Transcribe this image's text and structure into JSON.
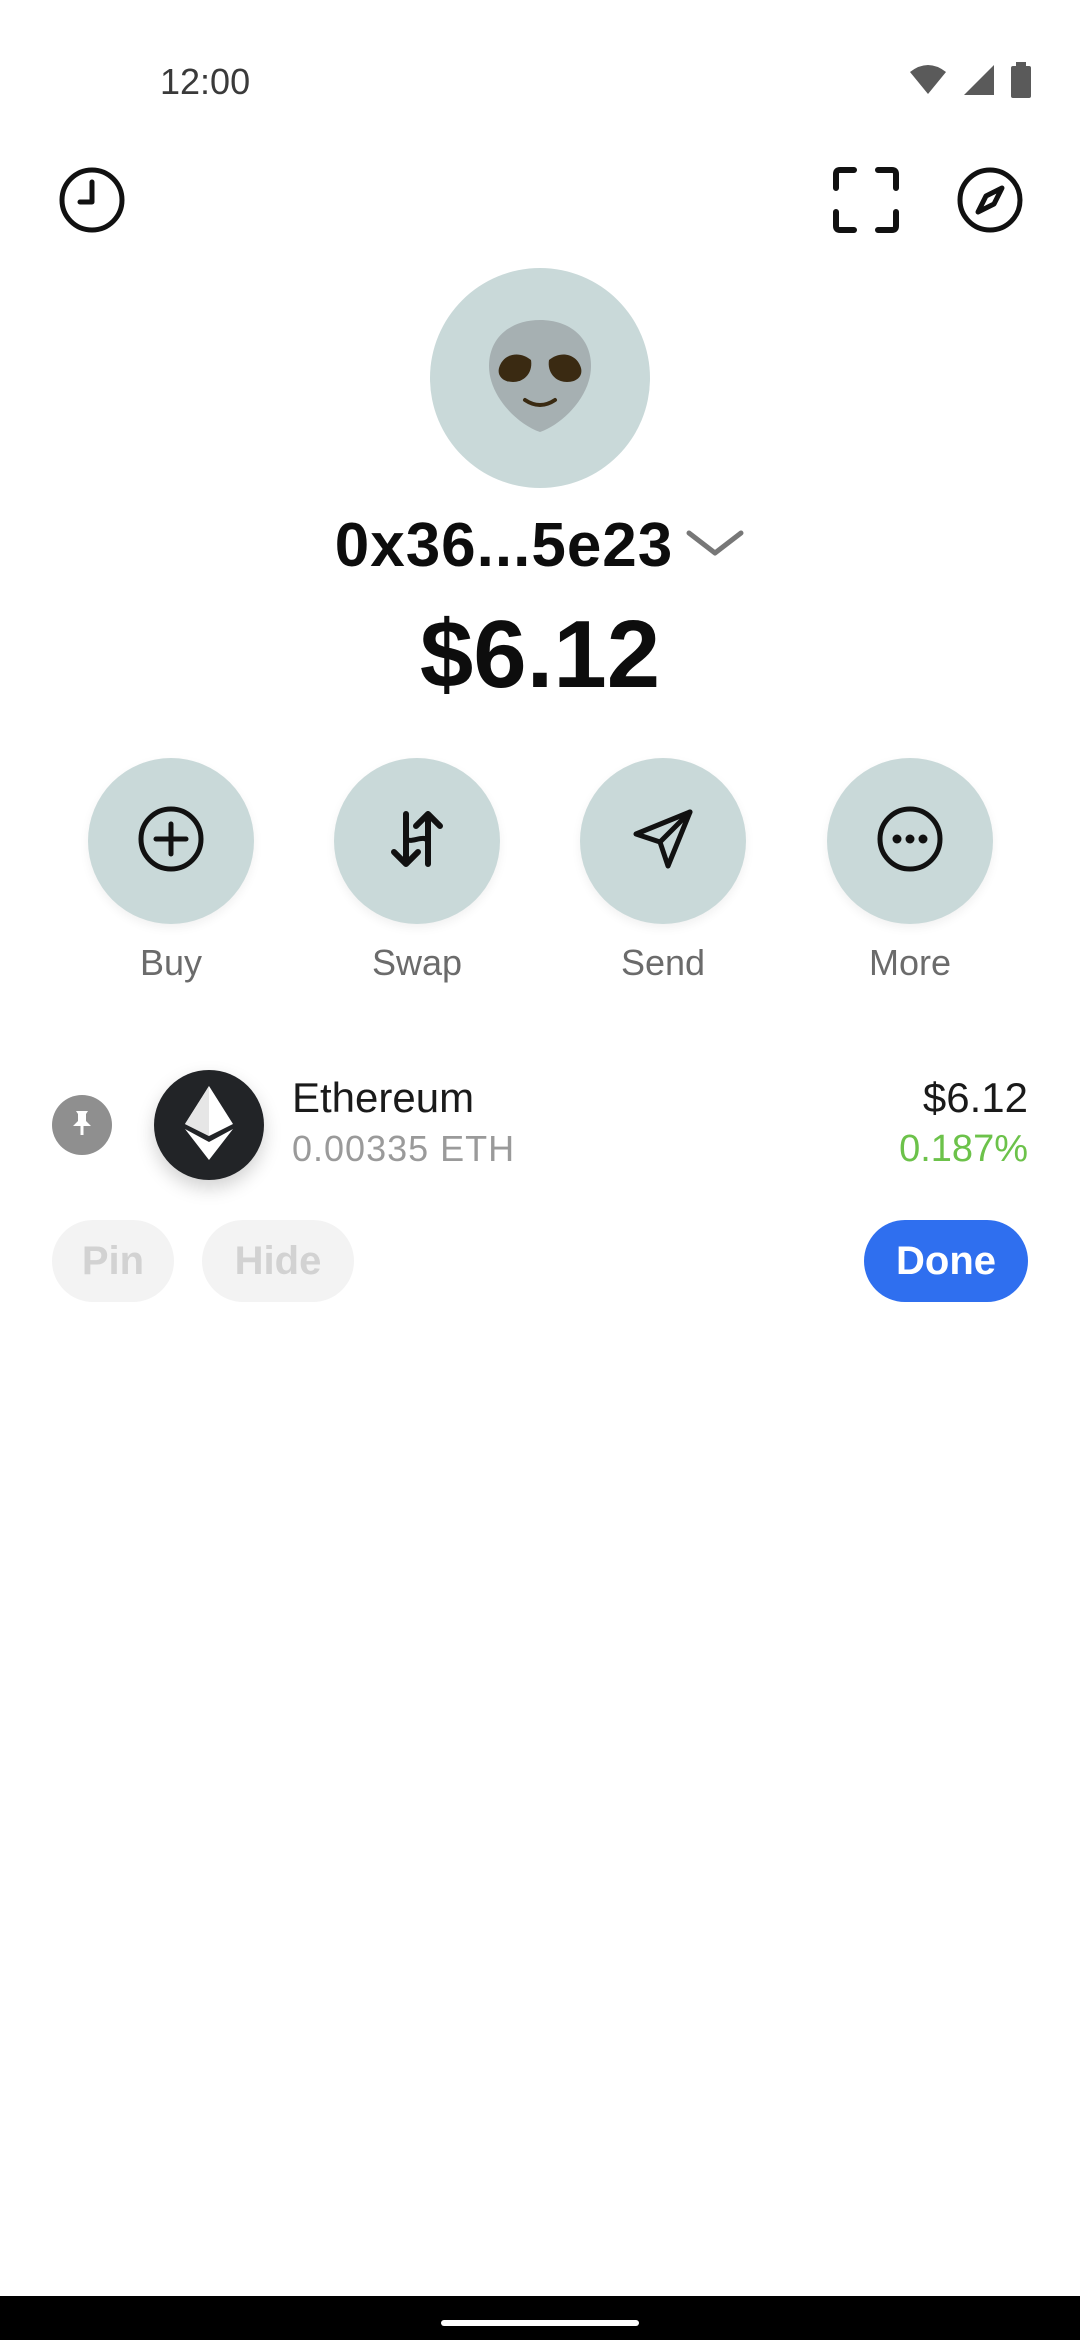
{
  "status_bar": {
    "time": "12:00",
    "icons": [
      "wifi-icon",
      "signal-icon",
      "battery-icon"
    ]
  },
  "top_bar": {
    "icons": [
      "history-icon",
      "scan-icon",
      "compass-icon"
    ]
  },
  "account": {
    "avatar_icon": "alien-icon",
    "address": "0x36...5e23",
    "balance": "$6.12"
  },
  "actions": [
    {
      "label": "Buy",
      "icon": "plus-circle-icon"
    },
    {
      "label": "Swap",
      "icon": "swap-arrows-icon"
    },
    {
      "label": "Send",
      "icon": "send-icon"
    },
    {
      "label": "More",
      "icon": "more-dots-icon"
    }
  ],
  "tokens": [
    {
      "name": "Ethereum",
      "amount": "0.00335 ETH",
      "value": "$6.12",
      "change": "0.187%",
      "icon": "ethereum-icon",
      "pinned": true
    }
  ],
  "edit_controls": {
    "pin_label": "Pin",
    "hide_label": "Hide",
    "done_label": "Done"
  },
  "colors": {
    "accent": "#2f6fef",
    "positive": "#6cc24a",
    "action_bg": "#c9d9d9"
  }
}
